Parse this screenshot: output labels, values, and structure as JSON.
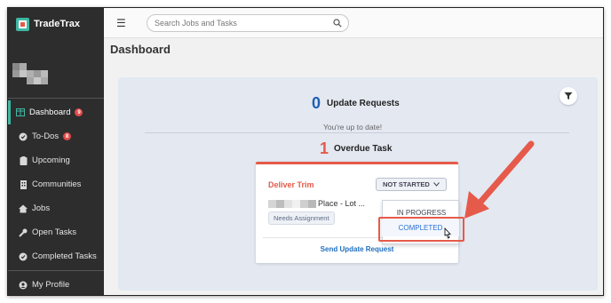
{
  "app": {
    "name": "TradeTrax"
  },
  "colors": {
    "accent": "#3fb8a3",
    "danger": "#e55a4a",
    "link": "#1e6fc0",
    "sidebar": "#2d2d2d"
  },
  "sidebar": {
    "items": [
      {
        "label": "Dashboard",
        "icon": "dashboard-icon",
        "badge": "9",
        "active": true
      },
      {
        "label": "To-Dos",
        "icon": "check-circle-icon",
        "badge": "8"
      },
      {
        "label": "Upcoming",
        "icon": "clipboard-icon"
      },
      {
        "label": "Communities",
        "icon": "building-icon"
      },
      {
        "label": "Jobs",
        "icon": "house-icon"
      },
      {
        "label": "Open Tasks",
        "icon": "wrench-icon"
      },
      {
        "label": "Completed Tasks",
        "icon": "check-circle-icon"
      },
      {
        "label": "My Profile",
        "icon": "user-circle-icon"
      }
    ]
  },
  "topbar": {
    "search_placeholder": "Search Jobs and Tasks"
  },
  "page": {
    "title": "Dashboard"
  },
  "update_requests": {
    "count": "0",
    "label": "Update Requests",
    "message": "You're up to date!"
  },
  "overdue": {
    "count": "1",
    "label": "Overdue Task"
  },
  "card": {
    "title": "Deliver Trim",
    "status": "NOT STARTED",
    "location": "Place - Lot ...",
    "tag": "Needs Assignment",
    "action": "Send Update Request"
  },
  "status_menu": {
    "options": [
      "IN PROGRESS",
      "COMPLETED"
    ],
    "highlighted": "COMPLETED"
  }
}
